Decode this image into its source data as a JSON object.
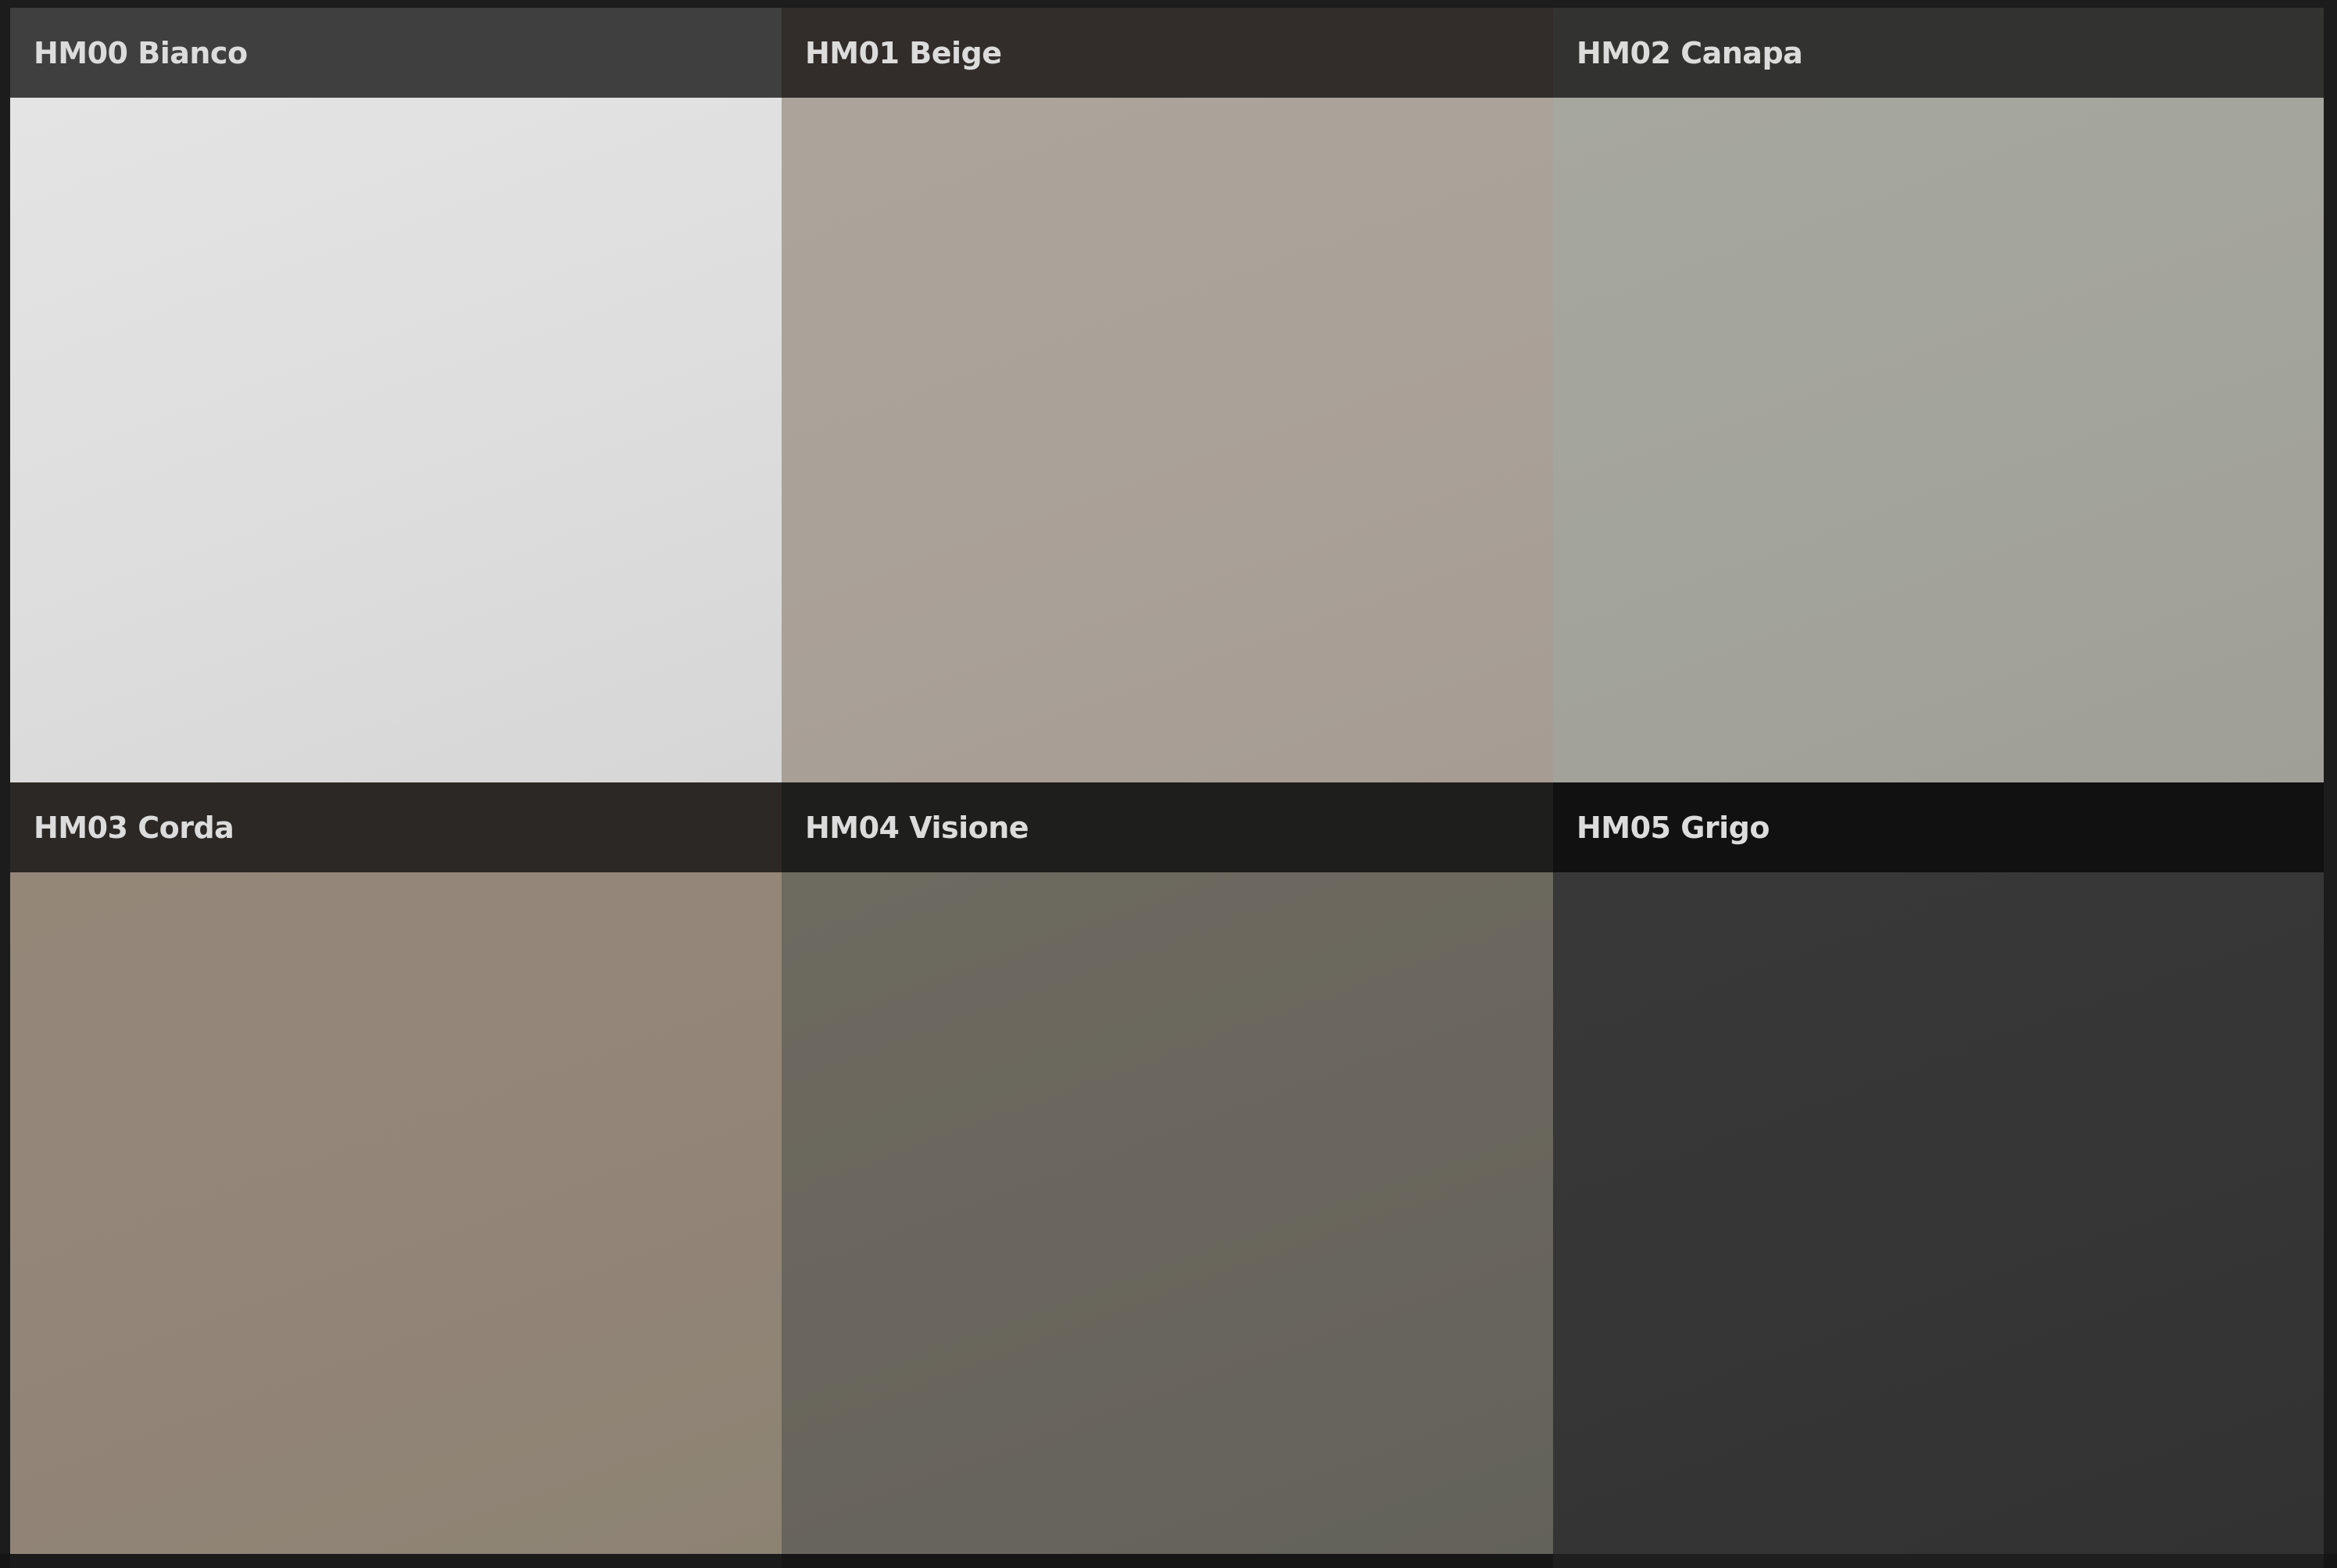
{
  "swatches": [
    {
      "code_name": "HM00 Bianco",
      "header_color": "#3f3f3f",
      "sample_color": "#dedede",
      "sample_gradient": [
        "#e4e4e4",
        "#d6d6d6"
      ]
    },
    {
      "code_name": "HM01 Beige",
      "header_color": "#322d2a",
      "sample_color": "#aaa198",
      "sample_gradient": [
        "#aca49b",
        "#a69c94"
      ]
    },
    {
      "code_name": "HM02 Canapa",
      "header_color": "#323230",
      "sample_color": "#a3a49c",
      "sample_gradient": [
        "#a6a79e",
        "#a09f97"
      ]
    },
    {
      "code_name": "HM03 Corda",
      "header_color": "#2c2825",
      "sample_color": "#938578",
      "sample_gradient": [
        "#958778",
        "#8d8373"
      ]
    },
    {
      "code_name": "HM04 Visione",
      "header_color": "#1e1e1c",
      "sample_color": "#6a665d",
      "sample_gradient": [
        "#6d6a60",
        "#63625a"
      ]
    },
    {
      "code_name": "HM05 Grigo",
      "header_color": "#111111",
      "sample_color": "#363636",
      "sample_gradient": [
        "#383838",
        "#323232"
      ]
    }
  ]
}
